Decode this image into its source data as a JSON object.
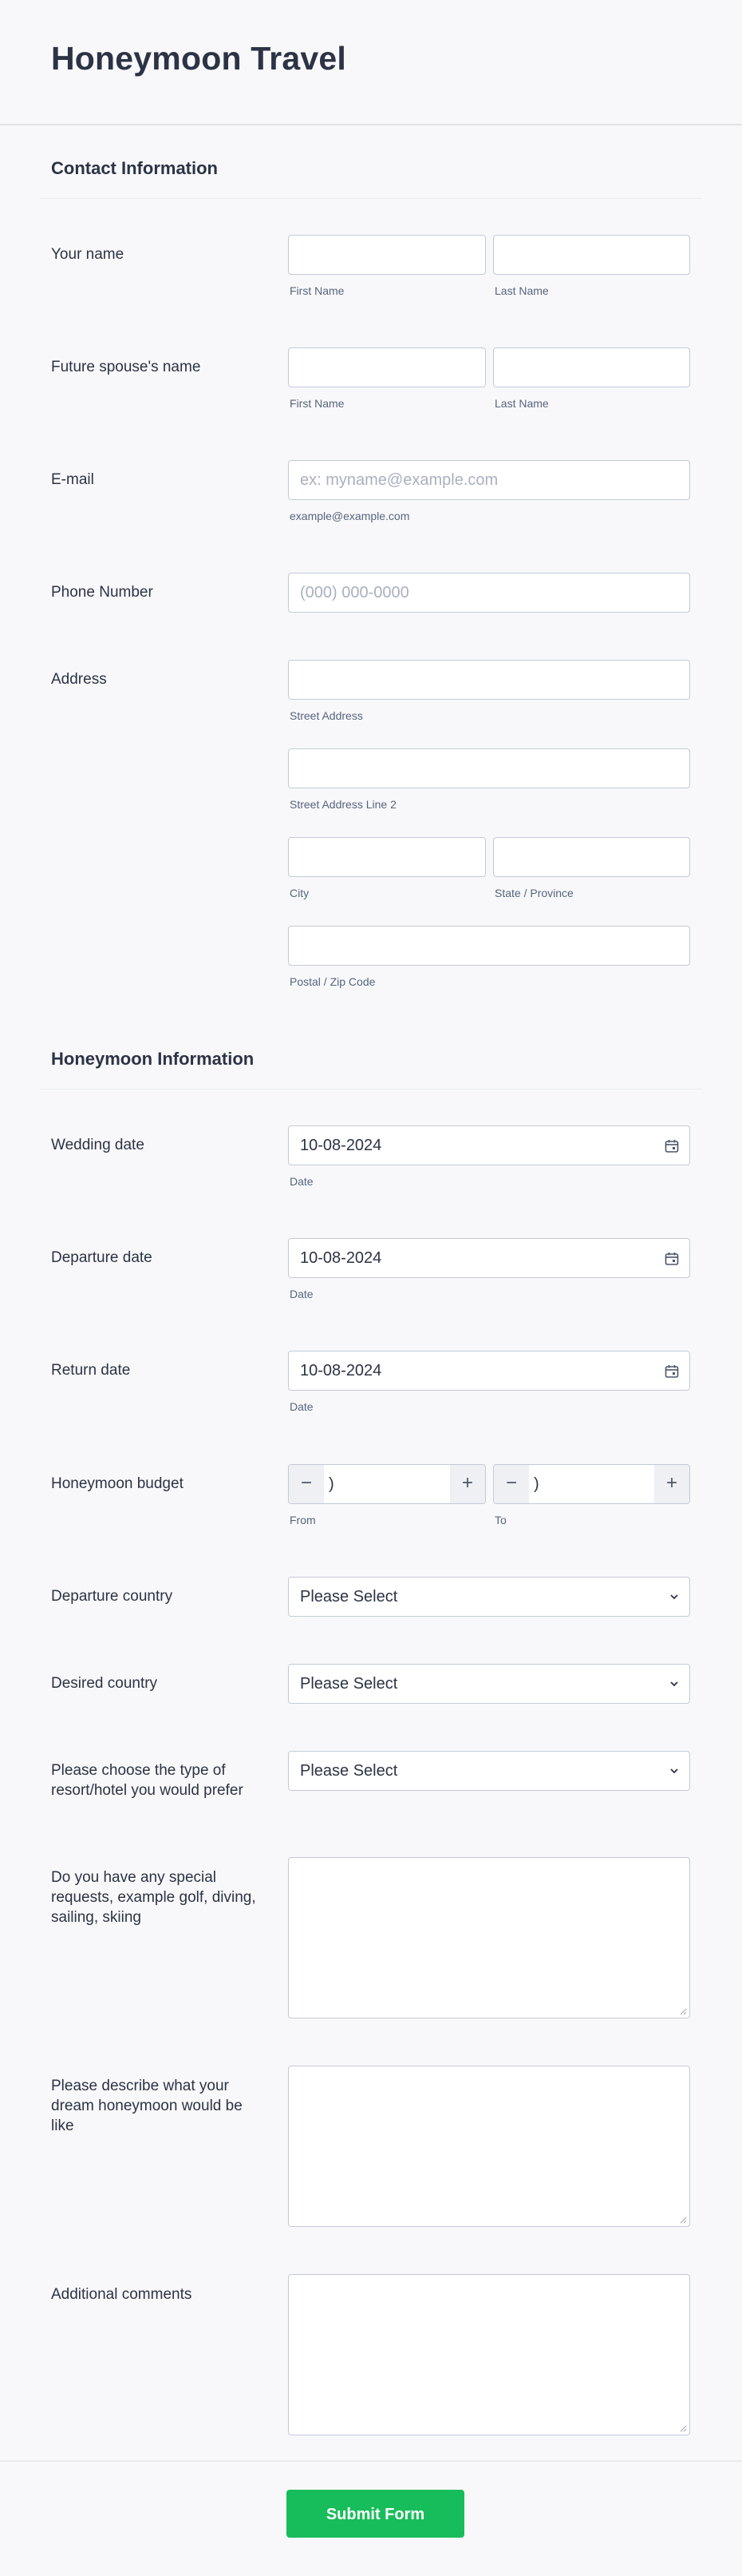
{
  "form": {
    "title": "Honeymoon Travel",
    "sections": {
      "contact": "Contact Information",
      "honeymoon": "Honeymoon Information"
    },
    "your_name": {
      "label": "Your name",
      "first_sub": "First Name",
      "last_sub": "Last Name"
    },
    "spouse_name": {
      "label": "Future spouse's name",
      "first_sub": "First Name",
      "last_sub": "Last Name"
    },
    "email": {
      "label": "E-mail",
      "placeholder": "ex: myname@example.com",
      "sub": "example@example.com"
    },
    "phone": {
      "label": "Phone Number",
      "placeholder": "(000) 000-0000"
    },
    "address": {
      "label": "Address",
      "street_sub": "Street Address",
      "street2_sub": "Street Address Line 2",
      "city_sub": "City",
      "state_sub": "State / Province",
      "zip_sub": "Postal / Zip Code"
    },
    "wedding_date": {
      "label": "Wedding date",
      "value": "10-08-2024",
      "sub": "Date"
    },
    "departure_date": {
      "label": "Departure date",
      "value": "10-08-2024",
      "sub": "Date"
    },
    "return_date": {
      "label": "Return date",
      "value": "10-08-2024",
      "sub": "Date"
    },
    "budget": {
      "label": "Honeymoon budget",
      "from_sub": "From",
      "to_sub": "To",
      "minus": "−",
      "plus": "+",
      "from_value": ")",
      "to_value": ")"
    },
    "departure_country": {
      "label": "Departure country",
      "value": "Please Select"
    },
    "desired_country": {
      "label": "Desired country",
      "value": "Please Select"
    },
    "resort_type": {
      "label": "Please choose the type of resort/hotel you would prefer",
      "value": "Please Select"
    },
    "special_requests": {
      "label": "Do you have any special requests, example golf, diving, sailing, skiing"
    },
    "dream": {
      "label": "Please describe what your dream honeymoon would be like"
    },
    "comments": {
      "label": "Additional comments"
    },
    "submit_label": "Submit Form"
  },
  "icons": {
    "calendar": "calendar-icon",
    "chevron": "chevron-down-icon",
    "resize": "resize-grip-icon"
  },
  "colors": {
    "accent": "#18bd5b",
    "text": "#2c3345",
    "border": "#c3cad8",
    "background": "#f8f8fa"
  }
}
